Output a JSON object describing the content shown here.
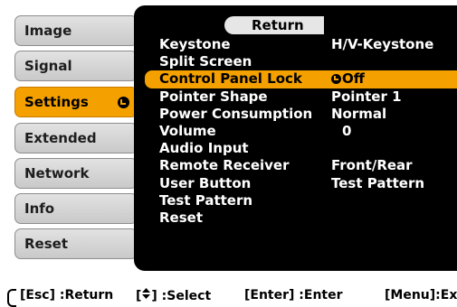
{
  "left_menu": [
    {
      "label": "Image",
      "active": false
    },
    {
      "label": "Signal",
      "active": false
    },
    {
      "label": "Settings",
      "active": true
    },
    {
      "label": "Extended",
      "active": false
    },
    {
      "label": "Network",
      "active": false
    },
    {
      "label": "Info",
      "active": false
    },
    {
      "label": "Reset",
      "active": false
    }
  ],
  "panel": {
    "return_label": "Return",
    "rows": [
      {
        "label": "Keystone",
        "value": "H/V-Keystone"
      },
      {
        "label": "Split Screen",
        "value": ""
      },
      {
        "label": "Control Panel Lock",
        "value": "Off"
      },
      {
        "label": "Pointer Shape",
        "value": "Pointer 1"
      },
      {
        "label": "Power Consumption",
        "value": "Normal"
      },
      {
        "label": "Volume",
        "value": "0"
      },
      {
        "label": "Audio Input",
        "value": ""
      },
      {
        "label": "Remote Receiver",
        "value": "Front/Rear"
      },
      {
        "label": "User Button",
        "value": "Test Pattern"
      },
      {
        "label": "Test Pattern",
        "value": ""
      },
      {
        "label": "Reset",
        "value": ""
      }
    ]
  },
  "footer": {
    "esc": "[Esc] :Return",
    "select_prefix": "[",
    "select_suffix": "] :Select",
    "enter": "[Enter] :Enter",
    "menu": "[Menu]:Exit"
  },
  "colors": {
    "highlight": "#f4a100",
    "panel_bg": "#000000",
    "menu_bg": "#d6d6d6"
  }
}
